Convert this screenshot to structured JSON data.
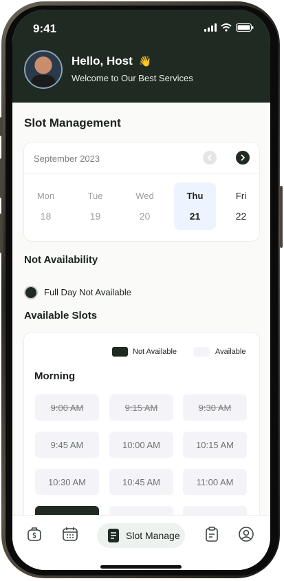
{
  "status": {
    "time": "9:41"
  },
  "header": {
    "greeting": "Hello, Host",
    "greeting_emoji": "👋",
    "subtitle": "Welcome to Our Best Services"
  },
  "slot_management": {
    "title": "Slot Management",
    "month": "September 2023",
    "days": [
      {
        "name": "Mon",
        "num": "18",
        "selected": false
      },
      {
        "name": "Tue",
        "num": "19",
        "selected": false
      },
      {
        "name": "Wed",
        "num": "20",
        "selected": false
      },
      {
        "name": "Thu",
        "num": "21",
        "selected": true
      },
      {
        "name": "Fri",
        "num": "22",
        "selected": false
      }
    ]
  },
  "not_availability": {
    "title": "Not Availability",
    "option": "Full Day Not Available"
  },
  "available_slots": {
    "title": "Available Slots",
    "legend": {
      "not_available": "Not Available",
      "available": "Available"
    },
    "morning_title": "Morning",
    "slots": [
      "9:00 AM",
      "9:15 AM",
      "9:30 AM",
      "9:45 AM",
      "10:00 AM",
      "10:15 AM",
      "10:30 AM",
      "10:45 AM",
      "11:00 AM"
    ]
  },
  "tabbar": {
    "active_label": "Slot Manage"
  },
  "colors": {
    "brand_dark": "#1f2a22",
    "available": "#f4f4f8",
    "selected_day": "#eef4ff"
  }
}
